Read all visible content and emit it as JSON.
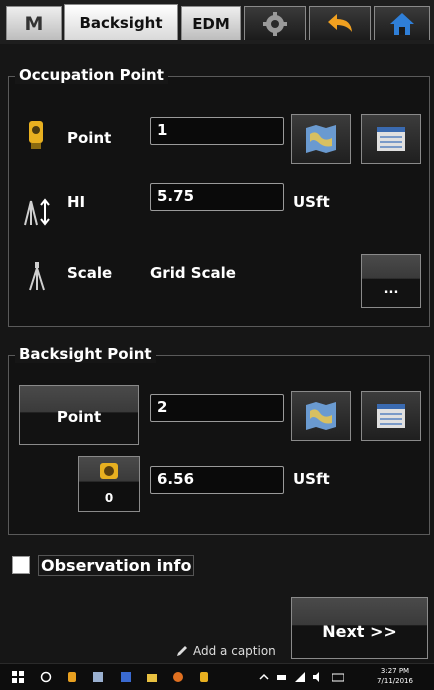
{
  "tabs": {
    "menu_label": "M",
    "backsight_label": "Backsight",
    "edm_label": "EDM"
  },
  "occupation": {
    "title": "Occupation Point",
    "point_label": "Point",
    "point_value": "1",
    "hi_label": "HI",
    "hi_value": "5.75",
    "hi_unit": "USft",
    "scale_label": "Scale",
    "scale_value": "Grid Scale",
    "more_label": "..."
  },
  "backsight": {
    "title": "Backsight Point",
    "point_button": "Point",
    "point_value": "2",
    "target_count": "0",
    "height_value": "6.56",
    "height_unit": "USft"
  },
  "observation_info_label": "Observation info",
  "next_label": "Next >>",
  "caption_label": "Add a caption",
  "taskbar": {
    "time": "3:27 PM",
    "date": "7/11/2016"
  }
}
